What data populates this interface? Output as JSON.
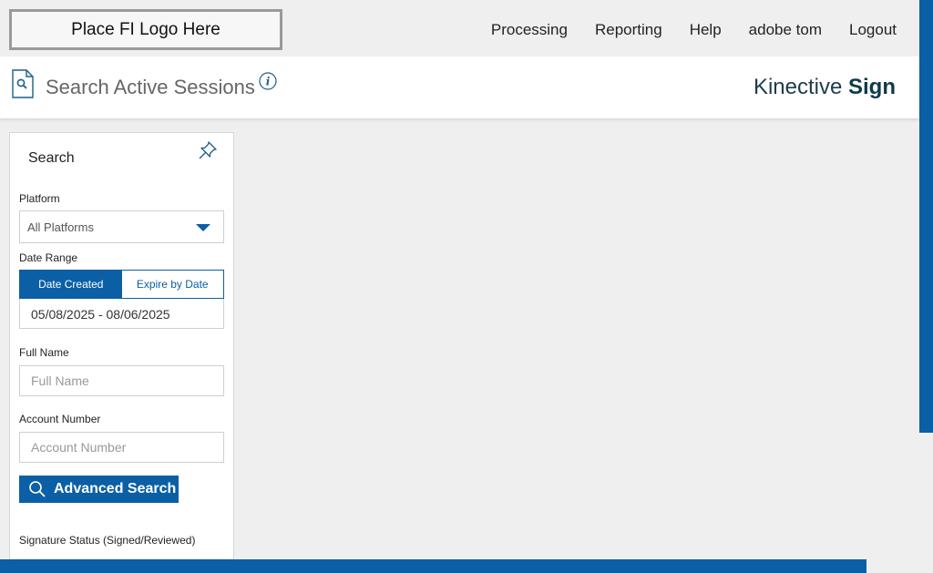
{
  "header": {
    "logo_text": "Place FI Logo Here",
    "nav": [
      "Processing",
      "Reporting",
      "Help",
      "adobe tom",
      "Logout"
    ]
  },
  "page": {
    "title": "Search Active Sessions",
    "brand_light": "Kinective",
    "brand_bold": "Sign"
  },
  "search": {
    "title": "Search",
    "platform_label": "Platform",
    "platform_value": "All Platforms",
    "date_range_label": "Date Range",
    "date_tabs": [
      "Date Created",
      "Expire by Date"
    ],
    "date_value": "05/08/2025 - 08/06/2025",
    "full_name_label": "Full Name",
    "full_name_placeholder": "Full Name",
    "account_label": "Account Number",
    "account_placeholder": "Account Number",
    "advanced_button": "Advanced Search",
    "signature_status_label": "Signature Status (Signed/Reviewed)"
  },
  "icons": {
    "doc": "search-document-icon",
    "info": "info-icon",
    "pin": "pin-icon",
    "search": "search-icon"
  },
  "colors": {
    "primary": "#0b5fa5",
    "brand_text": "#1c3d4d",
    "background": "#efefef"
  }
}
